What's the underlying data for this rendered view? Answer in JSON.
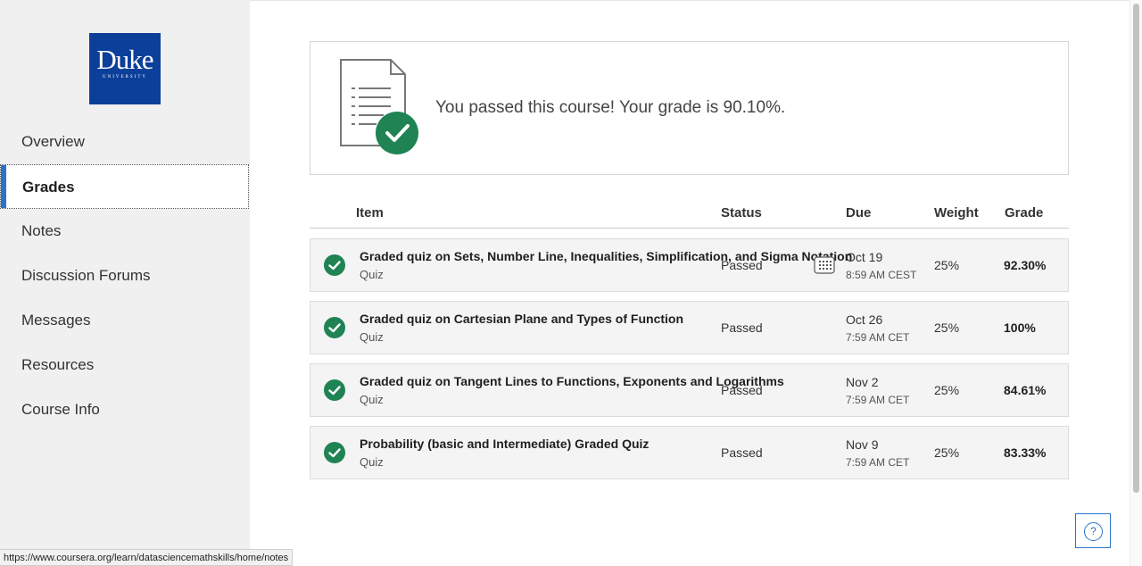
{
  "logo": {
    "text": "Duke",
    "subtext": "UNIVERSITY"
  },
  "sidebar": {
    "items": [
      {
        "label": "Overview",
        "active": false
      },
      {
        "label": "Grades",
        "active": true
      },
      {
        "label": "Notes",
        "active": false
      },
      {
        "label": "Discussion Forums",
        "active": false
      },
      {
        "label": "Messages",
        "active": false
      },
      {
        "label": "Resources",
        "active": false
      },
      {
        "label": "Course Info",
        "active": false
      }
    ]
  },
  "banner": {
    "message": "You passed this course! Your grade is 90.10%.",
    "icon": "document-check-icon"
  },
  "table": {
    "headers": {
      "item": "Item",
      "status": "Status",
      "due": "Due",
      "weight": "Weight",
      "grade": "Grade"
    },
    "rows": [
      {
        "title": "Graded quiz on Sets, Number Line, Inequalities, Simplification, and Sigma Notation",
        "type": "Quiz",
        "status": "Passed",
        "due_date": "Oct 19",
        "due_time": "8:59 AM CEST",
        "weight": "25%",
        "grade": "92.30%"
      },
      {
        "title": "Graded quiz on Cartesian Plane and Types of Function",
        "type": "Quiz",
        "status": "Passed",
        "due_date": "Oct 26",
        "due_time": "7:59 AM CET",
        "weight": "25%",
        "grade": "100%"
      },
      {
        "title": "Graded quiz on Tangent Lines to Functions, Exponents and Logarithms",
        "type": "Quiz",
        "status": "Passed",
        "due_date": "Nov 2",
        "due_time": "7:59 AM CET",
        "weight": "25%",
        "grade": "84.61%"
      },
      {
        "title": "Probability (basic and Intermediate) Graded Quiz",
        "type": "Quiz",
        "status": "Passed",
        "due_date": "Nov 9",
        "due_time": "7:59 AM CET",
        "weight": "25%",
        "grade": "83.33%"
      }
    ]
  },
  "help": {
    "label": "?"
  },
  "status_bar": {
    "url": "https://www.coursera.org/learn/datasciencemathskills/home/notes"
  },
  "colors": {
    "accent": "#2a73cc",
    "success": "#1f8354",
    "duke_blue": "#0c3f9a"
  }
}
